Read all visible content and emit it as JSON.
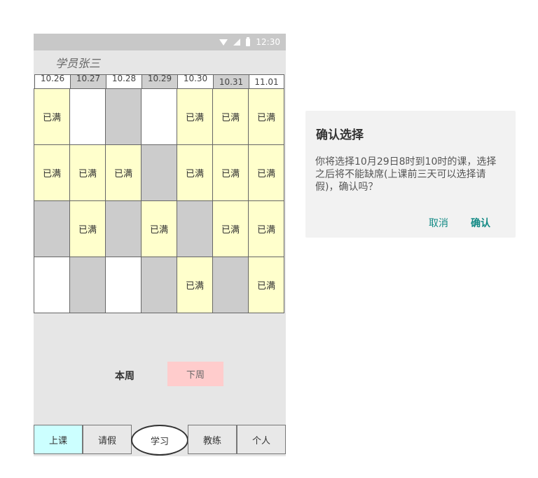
{
  "statusbar": {
    "time": "12:30",
    "icons": [
      "wifi-icon",
      "signal-icon",
      "battery-icon"
    ]
  },
  "header": {
    "student_name": "学员张三"
  },
  "calendar": {
    "dates": [
      {
        "label": "10.26",
        "style": "white"
      },
      {
        "label": "10.27",
        "style": "gray"
      },
      {
        "label": "10.28",
        "style": "white"
      },
      {
        "label": "10.29",
        "style": "gray"
      },
      {
        "label": "10.30",
        "style": "white"
      },
      {
        "label": "10.31",
        "style": "gray"
      },
      {
        "label": "11.01",
        "style": "white"
      }
    ],
    "full_label": "已满",
    "rows": [
      [
        "full",
        "empty",
        "gray",
        "empty",
        "full",
        "full",
        "full"
      ],
      [
        "full",
        "full",
        "full",
        "gray",
        "full",
        "full",
        "full"
      ],
      [
        "gray",
        "full",
        "gray",
        "full",
        "gray",
        "full",
        "full"
      ],
      [
        "empty",
        "gray",
        "empty",
        "gray",
        "full",
        "gray",
        "full"
      ]
    ]
  },
  "week_nav": {
    "this_week": "本周",
    "next_week": "下周"
  },
  "tabs": [
    {
      "label": "上课",
      "state": "active"
    },
    {
      "label": "请假",
      "state": "normal"
    },
    {
      "label": "学习",
      "state": "center"
    },
    {
      "label": "教练",
      "state": "normal"
    },
    {
      "label": "个人",
      "state": "normal"
    }
  ],
  "dialog": {
    "title": "确认选择",
    "message": "你将选择10月29日8时到10时的课，选择之后将不能缺席(上课前三天可以选择请假)，确认吗？",
    "cancel_label": "取消",
    "confirm_label": "确认"
  },
  "colors": {
    "full_cell": "#ffffcc",
    "gray_cell": "#cccccc",
    "active_tab": "#ccffff",
    "next_week_button": "#ffcccc",
    "accent": "#138a85"
  }
}
